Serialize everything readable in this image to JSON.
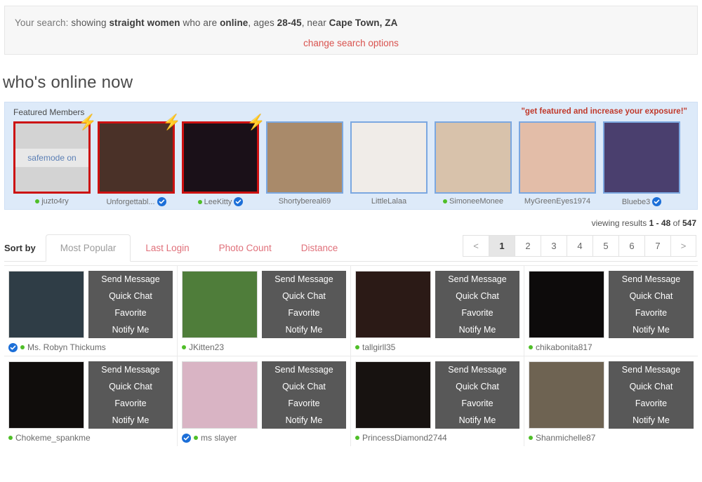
{
  "search": {
    "lead": "Your search:",
    "prefix": "showing ",
    "orientation": "straight women",
    "mid1": " who are ",
    "status": "online",
    "mid2": ", ages ",
    "ages": "28-45",
    "mid3": ", near ",
    "location": "Cape Town, ZA",
    "change_link": "change search options"
  },
  "page_title": "who's online now",
  "featured": {
    "title": "Featured Members",
    "promo": "\"get featured and increase your exposure!\"",
    "safemode_label": "safemode on",
    "members": [
      {
        "name": "juzto4ry",
        "border": "red",
        "bolt": true,
        "online": true,
        "verified": false,
        "safemode": true,
        "bg": "#d3d3d3"
      },
      {
        "name": "Unforgettabl...",
        "border": "red",
        "bolt": true,
        "online": false,
        "verified": true,
        "safemode": false,
        "bg": "#4a3128"
      },
      {
        "name": "LeeKitty",
        "border": "red",
        "bolt": true,
        "online": true,
        "verified": true,
        "safemode": false,
        "bg": "#1a1018"
      },
      {
        "name": "Shortybereal69",
        "border": "blue",
        "bolt": false,
        "online": false,
        "verified": false,
        "safemode": false,
        "bg": "#a98a6a"
      },
      {
        "name": "LittleLalaa",
        "border": "blue",
        "bolt": false,
        "online": false,
        "verified": false,
        "safemode": false,
        "bg": "#f0ece8"
      },
      {
        "name": "SimoneeMonee",
        "border": "blue",
        "bolt": false,
        "online": true,
        "verified": false,
        "safemode": false,
        "bg": "#d8c2ab"
      },
      {
        "name": "MyGreenEyes1974",
        "border": "blue",
        "bolt": false,
        "online": false,
        "verified": false,
        "safemode": false,
        "bg": "#e3bda8"
      },
      {
        "name": "Bluebe3",
        "border": "blue",
        "bolt": false,
        "online": false,
        "verified": true,
        "safemode": false,
        "bg": "#4a3f6e"
      }
    ]
  },
  "results_meta": {
    "prefix": "viewing results ",
    "range": "1 - 48",
    "mid": " of ",
    "total": "547"
  },
  "sort": {
    "label": "Sort by",
    "tabs": [
      {
        "label": "Most Popular",
        "active": true
      },
      {
        "label": "Last Login",
        "active": false
      },
      {
        "label": "Photo Count",
        "active": false
      },
      {
        "label": "Distance",
        "active": false
      }
    ]
  },
  "pagination": {
    "prev": "<",
    "next": ">",
    "pages": [
      "1",
      "2",
      "3",
      "4",
      "5",
      "6",
      "7"
    ],
    "current": "1"
  },
  "actions": [
    "Send Message",
    "Quick Chat",
    "Favorite",
    "Notify Me"
  ],
  "results": [
    {
      "name": "Ms. Robyn Thickums",
      "online": true,
      "verified": true,
      "bg": "#2f3d46"
    },
    {
      "name": "JKitten23",
      "online": true,
      "verified": false,
      "bg": "#4f7d3a"
    },
    {
      "name": "tallgirll35",
      "online": true,
      "verified": false,
      "bg": "#2b1a16"
    },
    {
      "name": "chikabonita817",
      "online": true,
      "verified": false,
      "bg": "#0d0b0b"
    },
    {
      "name": "Chokeme_spankme",
      "online": true,
      "verified": false,
      "bg": "#100d0c"
    },
    {
      "name": "ms slayer",
      "online": true,
      "verified": true,
      "bg": "#d9b4c4"
    },
    {
      "name": "PrincessDiamond2744",
      "online": true,
      "verified": false,
      "bg": "#171210"
    },
    {
      "name": "Shanmichelle87",
      "online": true,
      "verified": false,
      "bg": "#6e6352"
    }
  ],
  "colors": {
    "accent_link": "#d9534f",
    "featured_bg": "#ddeaf9",
    "featured_red": "#cc1111",
    "featured_blue": "#7ba7e0",
    "online_green": "#4fbe28",
    "verified_blue": "#1c6fd8",
    "action_panel": "#585858"
  }
}
